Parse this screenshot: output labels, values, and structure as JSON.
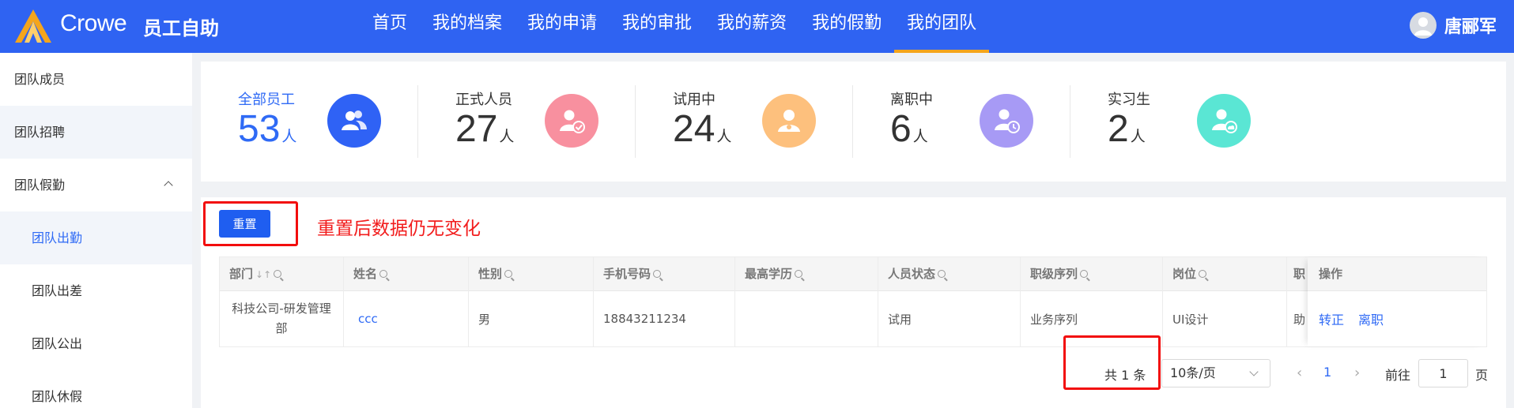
{
  "header": {
    "brand": "Crowe",
    "app_name": "员工自助",
    "nav": [
      {
        "label": "首页"
      },
      {
        "label": "我的档案"
      },
      {
        "label": "我的申请"
      },
      {
        "label": "我的审批"
      },
      {
        "label": "我的薪资"
      },
      {
        "label": "我的假勤"
      },
      {
        "label": "我的团队",
        "active": true
      }
    ],
    "user_name": "唐郦军",
    "accent": "#2f63f2",
    "active_underline": "#f4a51c"
  },
  "sidebar": {
    "items": [
      {
        "label": "团队成员"
      },
      {
        "label": "团队招聘"
      },
      {
        "label": "团队假勤",
        "expanded": true,
        "icon": "chevron-up-icon"
      },
      {
        "label": "团队出勤",
        "active": true
      },
      {
        "label": "团队出差"
      },
      {
        "label": "团队公出"
      },
      {
        "label": "团队休假"
      }
    ]
  },
  "stats": [
    {
      "label": "全部员工",
      "value": "53",
      "unit": "人",
      "icon": "group-icon",
      "color": "#2f62f5"
    },
    {
      "label": "正式人员",
      "value": "27",
      "unit": "人",
      "icon": "user-check-icon",
      "color": "#f8909f"
    },
    {
      "label": "试用中",
      "value": "24",
      "unit": "人",
      "icon": "user-badge-icon",
      "color": "#fdc07d"
    },
    {
      "label": "离职中",
      "value": "6",
      "unit": "人",
      "icon": "user-clock-icon",
      "color": "#a79af5"
    },
    {
      "label": "实习生",
      "value": "2",
      "unit": "人",
      "icon": "user-cloud-icon",
      "color": "#5ae6d4"
    }
  ],
  "toolbar": {
    "reset_label": "重置",
    "annotation": "重置后数据仍无变化",
    "annotation_color": "#f21d1d"
  },
  "table": {
    "columns": [
      "部门",
      "姓名",
      "性别",
      "手机号码",
      "最高学历",
      "人员状态",
      "职级序列",
      "岗位",
      "职",
      "操作"
    ],
    "rows": [
      {
        "dept": "科技公司-研发管理部",
        "name": "ccc",
        "gender": "男",
        "phone": "18843211234",
        "education": "",
        "status": "试用",
        "rank_series": "业务序列",
        "position": "UI设计",
        "title_cut": "助",
        "actions": [
          "转正",
          "离职"
        ]
      }
    ]
  },
  "pagination": {
    "total_text": "共 1 条",
    "page_size": "10条/页",
    "current_page": "1",
    "goto_label": "前往",
    "goto_value": "1",
    "page_suffix": "页"
  }
}
